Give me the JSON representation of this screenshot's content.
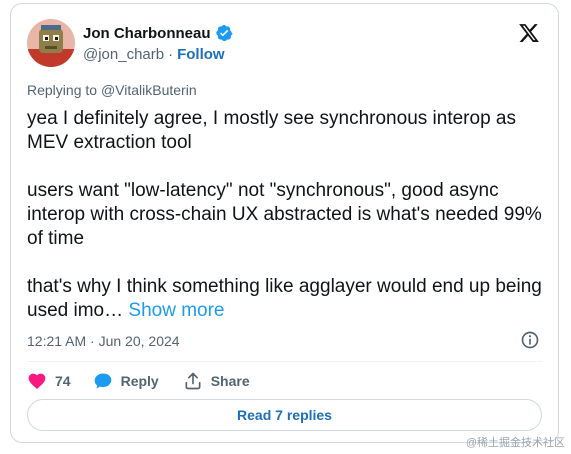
{
  "author": {
    "display_name": "Jon Charbonneau",
    "handle": "@jon_charb",
    "separator": "·",
    "follow_label": "Follow"
  },
  "reply": {
    "prefix": "Replying to",
    "mention": "@VitalikButerin"
  },
  "tweet": {
    "paragraphs": [
      "yea I definitely agree, I mostly see synchronous interop as MEV extraction tool",
      "users want \"low-latency\" not \"synchronous\", good async interop with cross-chain UX abstracted is what's needed 99% of time"
    ],
    "last_paragraph": "that's why I think something like agglayer would end up being used imo…",
    "show_more_label": "Show more"
  },
  "timestamp": "12:21 AM · Jun 20, 2024",
  "actions": {
    "like_count": "74",
    "reply_label": "Reply",
    "share_label": "Share"
  },
  "replies_button_label": "Read 7 replies",
  "watermark": "@稀土掘金技术社区",
  "colors": {
    "link_blue": "#1d6fb8",
    "show_more_blue": "#1d9bf0",
    "heart_pink": "#f91880",
    "reply_blue": "#1d9bf0",
    "muted_text": "#536471",
    "border": "#cfd9de"
  },
  "icons": {
    "verified": "verified-badge-icon",
    "logo": "x-logo-icon",
    "info": "info-icon",
    "like": "heart-icon",
    "reply": "reply-bubble-icon",
    "share": "share-icon"
  }
}
